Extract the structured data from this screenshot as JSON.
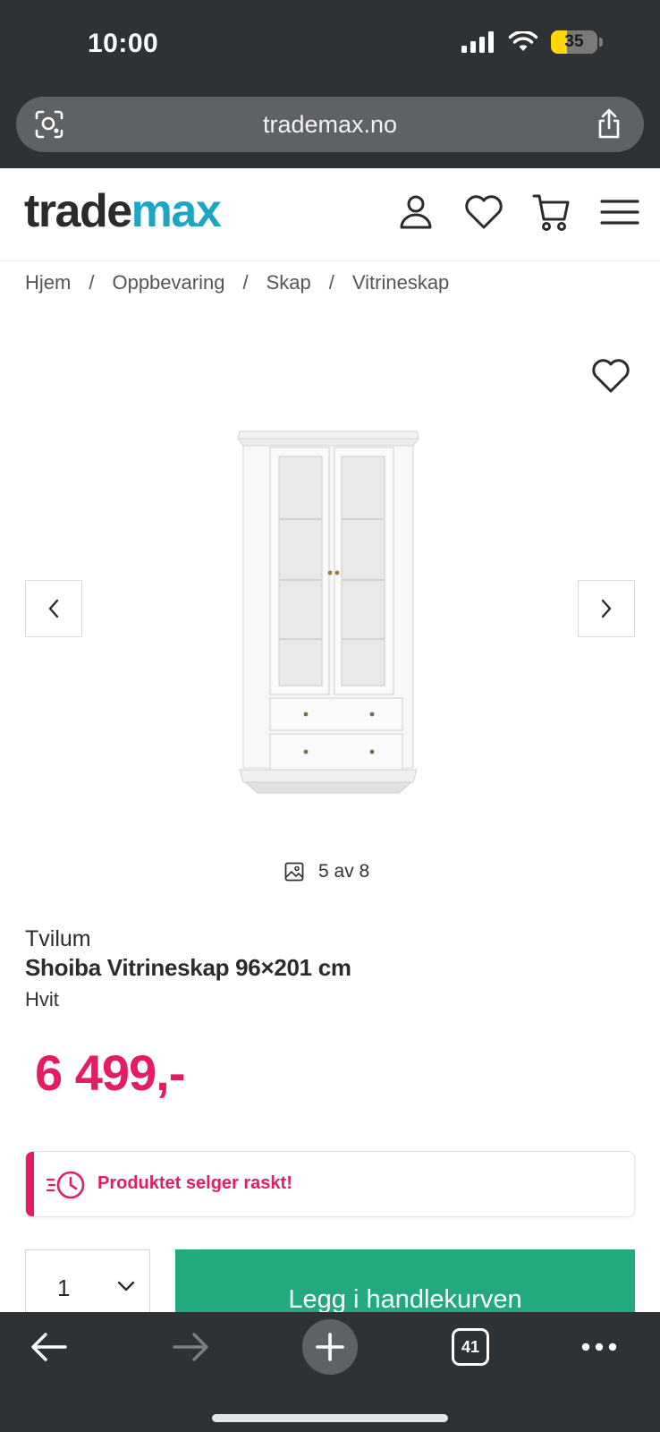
{
  "status": {
    "time": "10:00",
    "battery": "35",
    "battery_fraction": 0.35,
    "battery_color": "#ffd60a"
  },
  "browser": {
    "url": "trademax.no",
    "tab_count": "41"
  },
  "header": {
    "logo_part1": "trade",
    "logo_part2": "max",
    "accent": "#1aa6c4",
    "icons": [
      "account-icon",
      "wishlist-icon",
      "cart-icon",
      "menu-icon"
    ]
  },
  "breadcrumb": [
    "Hjem",
    "Oppbevaring",
    "Skap",
    "Vitrineskap"
  ],
  "breadcrumb_separator": "/",
  "gallery": {
    "counter": "5 av 8"
  },
  "product": {
    "brand": "Tvilum",
    "title": "Shoiba Vitrineskap 96×201 cm",
    "variant": "Hvit",
    "price": "6 499,-",
    "price_color": "#e31c63"
  },
  "alert": {
    "text": "Produktet selger raskt!",
    "color": "#e31c63"
  },
  "purchase": {
    "quantity": "1",
    "cta": "Legg i handlekurven",
    "cta_color": "#23a97e"
  }
}
